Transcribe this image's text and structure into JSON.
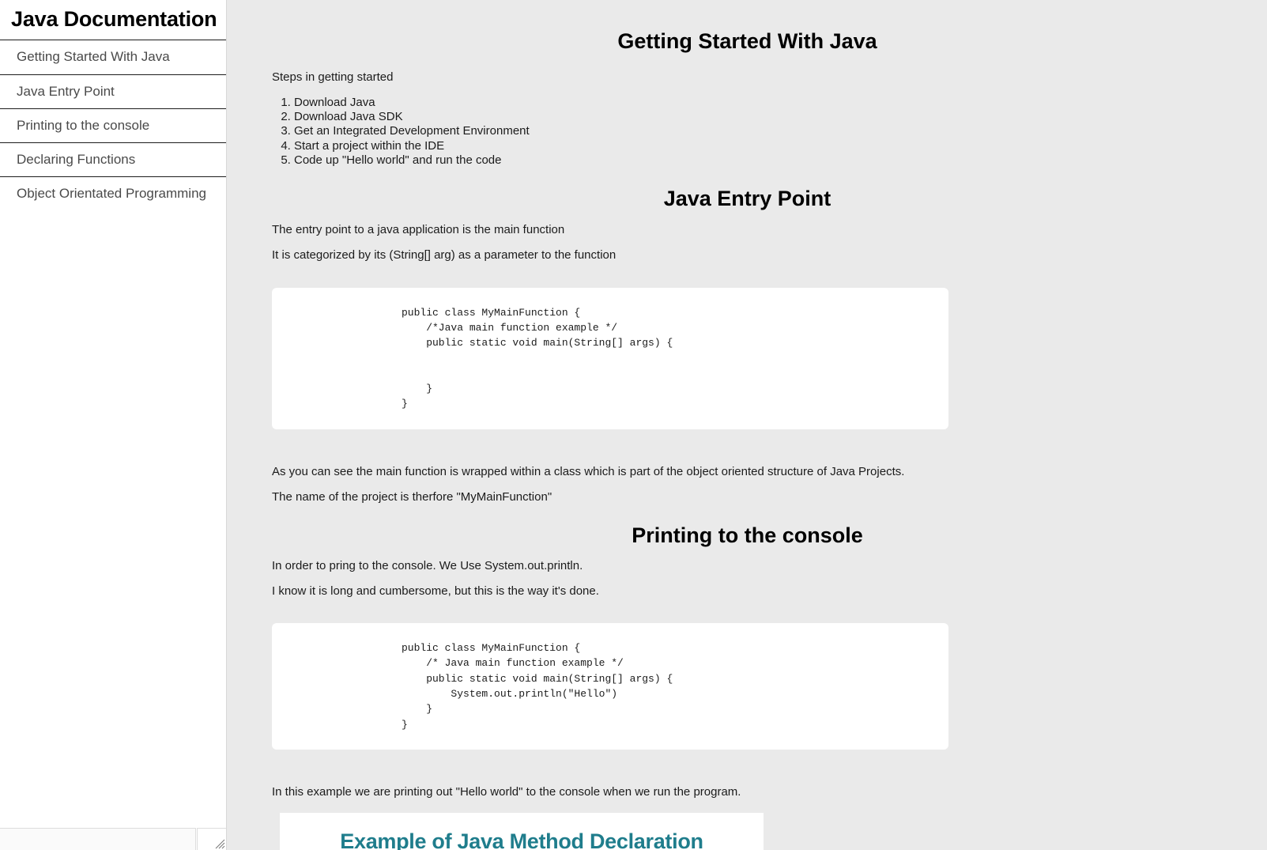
{
  "navbar": {
    "header": "Java Documentation",
    "items": [
      {
        "label": "Getting Started With Java"
      },
      {
        "label": "Java Entry Point"
      },
      {
        "label": "Printing to the console"
      },
      {
        "label": "Declaring Functions"
      },
      {
        "label": "Object Orientated Programming"
      }
    ],
    "resize_handle_icon": "resize-grip-icon"
  },
  "main": {
    "sections": [
      {
        "id": "getting-started",
        "title": "Getting Started With Java",
        "intro": "Steps in getting started",
        "steps": [
          "Download Java",
          "Download Java SDK",
          "Get an Integrated Development Environment",
          "Start a project within the IDE",
          "Code up \"Hello world\" and run the code"
        ]
      },
      {
        "id": "entry-point",
        "title": "Java Entry Point",
        "para1": "The entry point to a java application is the main function",
        "para2": "It is categorized by its (String[] arg) as a parameter to the function",
        "code": "public class MyMainFunction {\n    /*Java main function example */\n    public static void main(String[] args) {\n\n\n    }\n}",
        "para3": "As you can see the main function is wrapped within a class which is part of the object oriented structure of Java Projects.",
        "para4": "The name of the project is therfore \"MyMainFunction\""
      },
      {
        "id": "printing",
        "title": "Printing to the console",
        "para1": "In order to pring to the console. We Use System.out.println.",
        "para2": "I know it is long and cumbersome, but this is the way it's done.",
        "code": "public class MyMainFunction {\n    /* Java main function example */\n    public static void main(String[] args) {\n        System.out.println(\"Hello\")\n    }\n}",
        "para3": "In this example we are printing out \"Hello world\" to the console when we run the program.",
        "figure_title": "Example of Java Method Declaration"
      }
    ]
  },
  "colors": {
    "page_background": "#eaeaea",
    "sidebar_background": "#ffffff",
    "card_background": "#ffffff",
    "text": "#1b1b1b",
    "nav_link_text": "#4a4a4a",
    "figure_accent": "#1f7d8c"
  }
}
